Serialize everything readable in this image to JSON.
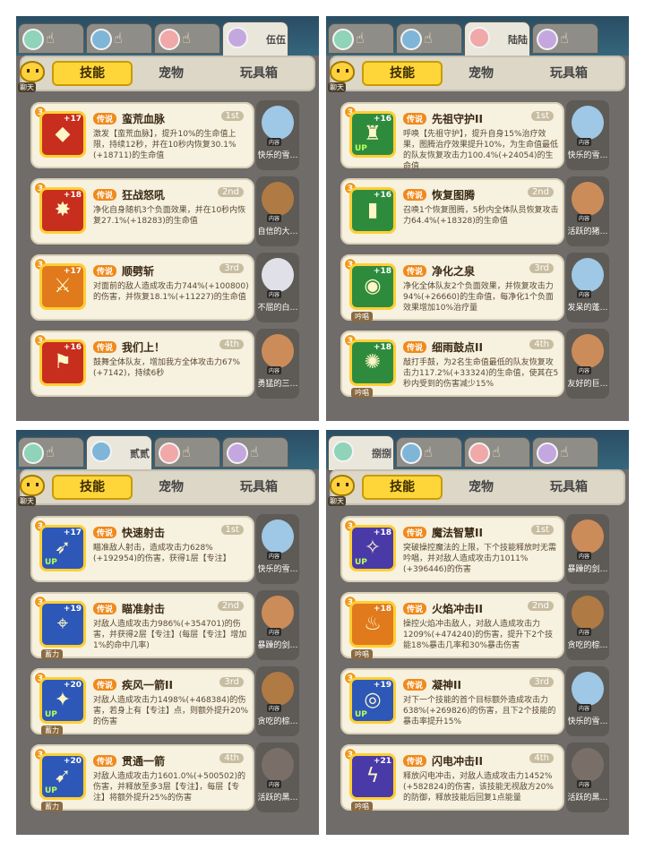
{
  "tabs": {
    "skill": "技能",
    "pet": "宠物",
    "toy": "玩具箱"
  },
  "chat_label": "聊天",
  "legend_label": "传说",
  "panels": [
    {
      "active_hero": "伍伍",
      "cards": [
        {
          "name": "蛮荒血脉",
          "order": "1st",
          "level": "+17",
          "desc": "激发【蛮荒血脉】，提升10%的生命值上限，持续12秒，并在10秒内恢复30.1%(+18711)的生命值",
          "pet": "快乐的雪…",
          "icon": "◆",
          "up": "",
          "tag": ""
        },
        {
          "name": "狂战怒吼",
          "order": "2nd",
          "level": "+18",
          "desc": "净化自身随机3个负面效果，并在10秒内恢复27.1%(+18283)的生命值",
          "pet": "自信的大…",
          "icon": "✸",
          "up": "",
          "tag": ""
        },
        {
          "name": "顺劈斩",
          "order": "3rd",
          "level": "+17",
          "desc": "对面前的敌人造成攻击力744%(+100800)的伤害，并恢复18.1%(+11227)的生命值",
          "pet": "不屈的白…",
          "icon": "⚔",
          "up": "",
          "tag": ""
        },
        {
          "name": "我们上！",
          "order": "4th",
          "level": "+16",
          "desc": "鼓舞全体队友，增加我方全体攻击力67%(+7142)，持续6秒",
          "pet": "勇猛的三…",
          "icon": "⚑",
          "up": "",
          "tag": ""
        }
      ]
    },
    {
      "active_hero": "陆陆",
      "cards": [
        {
          "name": "先祖守护II",
          "order": "1st",
          "level": "+16",
          "desc": "呼唤【先祖守护】，提升自身15%治疗效果，图腾治疗效果提升10%，为生命值最低的队友恢复攻击力100.4%(+24054)的生命值",
          "pet": "快乐的雪…",
          "icon": "♜",
          "up": "UP",
          "tag": ""
        },
        {
          "name": "恢复图腾",
          "order": "2nd",
          "level": "+16",
          "desc": "召唤1个恢复图腾，5秒内全体队员恢复攻击力64.4%(+18328)的生命值",
          "pet": "活跃的猪…",
          "icon": "▮",
          "up": "",
          "tag": ""
        },
        {
          "name": "净化之泉",
          "order": "3rd",
          "level": "+18",
          "desc": "净化全体队友2个负面效果，并恢复攻击力94%(+26660)的生命值，每净化1个负面效果增加10%治疗量",
          "pet": "发呆的蓬…",
          "icon": "◉",
          "up": "",
          "tag": "吟唱"
        },
        {
          "name": "细雨鼓点II",
          "order": "4th",
          "level": "+18",
          "desc": "敲打手鼓，为2名生命值最低的队友恢复攻击力117.2%(+33324)的生命值，使其在5秒内受到的伤害减少15%",
          "pet": "友好的巨…",
          "icon": "✺",
          "up": "",
          "tag": "吟唱"
        }
      ]
    },
    {
      "active_hero": "贰贰",
      "cards": [
        {
          "name": "快速射击",
          "order": "1st",
          "level": "+17",
          "desc": "瞄准敌人射击，造成攻击力628%(+192954)的伤害，获得1层【专注】",
          "pet": "快乐的雪…",
          "icon": "➶",
          "up": "UP",
          "tag": ""
        },
        {
          "name": "瞄准射击",
          "order": "2nd",
          "level": "+19",
          "desc": "对敌人造成攻击力986%(+354701)的伤害，并获得2层【专注】(每层【专注】增加1%的命中几率)",
          "pet": "暴躁的剑…",
          "icon": "⌖",
          "up": "",
          "tag": "蓄力"
        },
        {
          "name": "疾风一箭II",
          "order": "3rd",
          "level": "+20",
          "desc": "对敌人造成攻击力1498%(+468384)的伤害，若身上有【专注】点，则额外提升20%的伤害",
          "pet": "贪吃的棕…",
          "icon": "✦",
          "up": "UP",
          "tag": "蓄力"
        },
        {
          "name": "贯通一箭",
          "order": "4th",
          "level": "+20",
          "desc": "对敌人造成攻击力1601.0%(+500502)的伤害，并释放至多3层【专注】，每层【专注】将额外提升25%的伤害",
          "pet": "活跃的黑…",
          "icon": "➹",
          "up": "UP",
          "tag": "蓄力"
        }
      ]
    },
    {
      "active_hero": "捌捌",
      "cards": [
        {
          "name": "魔法智慧II",
          "order": "1st",
          "level": "+18",
          "desc": "突破操控魔法的上限，下个技能释放时无需吟唱，并对敌人造成攻击力1011%(+396446)的伤害",
          "pet": "暴躁的剑…",
          "icon": "✧",
          "up": "UP",
          "tag": ""
        },
        {
          "name": "火焰冲击II",
          "order": "2nd",
          "level": "+18",
          "desc": "操控火焰冲击敌人，对敌人造成攻击力1209%(+474240)的伤害，提升下2个技能18%暴击几率和30%暴击伤害",
          "pet": "贪吃的棕…",
          "icon": "♨",
          "up": "",
          "tag": "吟唱"
        },
        {
          "name": "凝神II",
          "order": "3rd",
          "level": "+19",
          "desc": "对下一个技能的首个目标额外造成攻击力638%(+269826)的伤害，且下2个技能的暴击率提升15%",
          "pet": "快乐的雪…",
          "icon": "◎",
          "up": "UP",
          "tag": ""
        },
        {
          "name": "闪电冲击II",
          "order": "4th",
          "level": "+21",
          "desc": "释放闪电冲击，对敌人造成攻击力1452%(+582824)的伤害，该技能无视敌方20%的防御，释放技能后回复1点能量",
          "pet": "活跃的黑…",
          "icon": "ϟ",
          "up": "",
          "tag": "吟唱"
        }
      ]
    }
  ]
}
